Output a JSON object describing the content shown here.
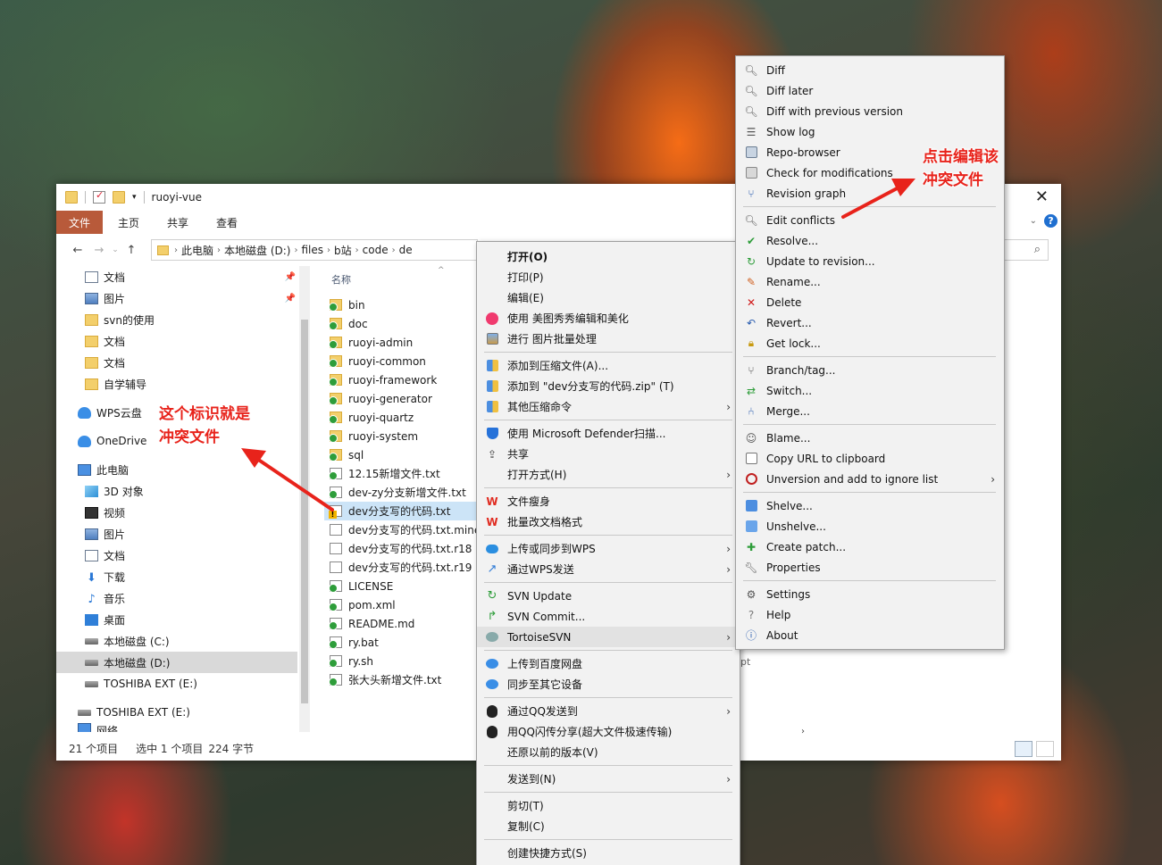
{
  "window": {
    "title": "ruoyi-vue",
    "tabs": [
      "文件",
      "主页",
      "共享",
      "查看"
    ],
    "breadcrumb": [
      "此电脑",
      "本地磁盘 (D:)",
      "files",
      "b站",
      "code",
      "de"
    ]
  },
  "nav_pane": [
    {
      "label": "文档",
      "icon": "doc",
      "pinned": true
    },
    {
      "label": "图片",
      "icon": "pic",
      "pinned": true
    },
    {
      "label": "svn的使用",
      "icon": "folder"
    },
    {
      "label": "文档",
      "icon": "folder"
    },
    {
      "label": "文档",
      "icon": "folder"
    },
    {
      "label": "自学辅导",
      "icon": "folder"
    },
    {
      "label": "WPS云盘",
      "icon": "cloud"
    },
    {
      "label": "OneDrive",
      "icon": "cloud"
    },
    {
      "label": "此电脑",
      "icon": "pc"
    },
    {
      "label": "3D 对象",
      "icon": "3d"
    },
    {
      "label": "视频",
      "icon": "video"
    },
    {
      "label": "图片",
      "icon": "pic"
    },
    {
      "label": "文档",
      "icon": "doc"
    },
    {
      "label": "下载",
      "icon": "down"
    },
    {
      "label": "音乐",
      "icon": "music"
    },
    {
      "label": "桌面",
      "icon": "desk"
    },
    {
      "label": "本地磁盘 (C:)",
      "icon": "drive"
    },
    {
      "label": "本地磁盘 (D:)",
      "icon": "drive",
      "selected": true
    },
    {
      "label": "TOSHIBA EXT (E:)",
      "icon": "drive"
    },
    {
      "label": "TOSHIBA EXT (E:)",
      "icon": "drive"
    },
    {
      "label": "网络",
      "icon": "pc"
    }
  ],
  "file_header": "名称",
  "files": [
    {
      "name": "bin",
      "type": "folder",
      "status": "ok"
    },
    {
      "name": "doc",
      "type": "folder",
      "status": "ok"
    },
    {
      "name": "ruoyi-admin",
      "type": "folder",
      "status": "ok"
    },
    {
      "name": "ruoyi-common",
      "type": "folder",
      "status": "ok"
    },
    {
      "name": "ruoyi-framework",
      "type": "folder",
      "status": "ok"
    },
    {
      "name": "ruoyi-generator",
      "type": "folder",
      "status": "ok"
    },
    {
      "name": "ruoyi-quartz",
      "type": "folder",
      "status": "ok"
    },
    {
      "name": "ruoyi-system",
      "type": "folder",
      "status": "ok"
    },
    {
      "name": "sql",
      "type": "folder",
      "status": "ok"
    },
    {
      "name": "12.15新增文件.txt",
      "type": "txt",
      "status": "ok"
    },
    {
      "name": "dev-zy分支新增文件.txt",
      "type": "txt",
      "status": "ok"
    },
    {
      "name": "dev分支写的代码.txt",
      "type": "txt",
      "status": "conflict",
      "selected": true
    },
    {
      "name": "dev分支写的代码.txt.mine",
      "type": "txt",
      "status": "none"
    },
    {
      "name": "dev分支写的代码.txt.r18",
      "type": "txt",
      "status": "none"
    },
    {
      "name": "dev分支写的代码.txt.r19",
      "type": "txt",
      "status": "none"
    },
    {
      "name": "LICENSE",
      "type": "txt",
      "status": "ok"
    },
    {
      "name": "pom.xml",
      "type": "txt",
      "status": "ok"
    },
    {
      "name": "README.md",
      "type": "txt",
      "status": "ok"
    },
    {
      "name": "ry.bat",
      "type": "txt",
      "status": "ok"
    },
    {
      "name": "ry.sh",
      "type": "txt",
      "status": "ok"
    },
    {
      "name": "张大头新增文件.txt",
      "type": "txt",
      "status": "ok"
    }
  ],
  "partial_text": "pt",
  "status_bar": {
    "count": "21 个项目",
    "selection": "选中 1 个项目",
    "size": "224 字节"
  },
  "context_menu": [
    {
      "label": "打开(O)",
      "bold": true
    },
    {
      "label": "打印(P)"
    },
    {
      "label": "编辑(E)"
    },
    {
      "label": "使用 美图秀秀编辑和美化",
      "icon": "meitu"
    },
    {
      "label": "进行 图片批量处理",
      "icon": "image"
    },
    {
      "sep": true
    },
    {
      "label": "添加到压缩文件(A)...",
      "icon": "zip"
    },
    {
      "label": "添加到 \"dev分支写的代码.zip\" (T)",
      "icon": "zip"
    },
    {
      "label": "其他压缩命令",
      "icon": "zip",
      "submenu": true
    },
    {
      "sep": true
    },
    {
      "label": "使用 Microsoft Defender扫描...",
      "icon": "shield"
    },
    {
      "label": "共享",
      "icon": "share"
    },
    {
      "label": "打开方式(H)",
      "submenu": true
    },
    {
      "sep": true
    },
    {
      "label": "文件瘦身",
      "icon": "wps"
    },
    {
      "label": "批量改文档格式",
      "icon": "wps"
    },
    {
      "sep": true
    },
    {
      "label": "上传或同步到WPS",
      "icon": "cloud",
      "submenu": true
    },
    {
      "label": "通过WPS发送",
      "icon": "send",
      "submenu": true
    },
    {
      "sep": true
    },
    {
      "label": "SVN Update",
      "icon": "svn-update"
    },
    {
      "label": "SVN Commit...",
      "icon": "svn-commit"
    },
    {
      "label": "TortoiseSVN",
      "icon": "tortoise",
      "submenu": true,
      "highlight": true
    },
    {
      "sep": true
    },
    {
      "label": "上传到百度网盘",
      "icon": "baidu"
    },
    {
      "label": "同步至其它设备",
      "icon": "baidu"
    },
    {
      "sep": true
    },
    {
      "label": "通过QQ发送到",
      "icon": "qq",
      "submenu": true
    },
    {
      "label": "用QQ闪传分享(超大文件极速传输)",
      "icon": "qq"
    },
    {
      "label": "还原以前的版本(V)"
    },
    {
      "sep": true
    },
    {
      "label": "发送到(N)",
      "submenu": true
    },
    {
      "sep": true
    },
    {
      "label": "剪切(T)"
    },
    {
      "label": "复制(C)"
    },
    {
      "sep": true
    },
    {
      "label": "创建快捷方式(S)"
    }
  ],
  "svn_menu": [
    {
      "label": "Diff",
      "icon": "magnifier"
    },
    {
      "label": "Diff later",
      "icon": "magnifier"
    },
    {
      "label": "Diff with previous version",
      "icon": "magnifier"
    },
    {
      "label": "Show log",
      "icon": "log"
    },
    {
      "label": "Repo-browser",
      "icon": "repo"
    },
    {
      "label": "Check for modifications",
      "icon": "check"
    },
    {
      "label": "Revision graph",
      "icon": "graph"
    },
    {
      "sep": true
    },
    {
      "label": "Edit conflicts",
      "icon": "magnifier"
    },
    {
      "label": "Resolve...",
      "icon": "resolve"
    },
    {
      "label": "Update to revision...",
      "icon": "update"
    },
    {
      "label": "Rename...",
      "icon": "rename"
    },
    {
      "label": "Delete",
      "icon": "delete"
    },
    {
      "label": "Revert...",
      "icon": "revert"
    },
    {
      "label": "Get lock...",
      "icon": "lock"
    },
    {
      "sep": true
    },
    {
      "label": "Branch/tag...",
      "icon": "branch"
    },
    {
      "label": "Switch...",
      "icon": "switch"
    },
    {
      "label": "Merge...",
      "icon": "merge"
    },
    {
      "sep": true
    },
    {
      "label": "Blame...",
      "icon": "blame"
    },
    {
      "label": "Copy URL to clipboard",
      "icon": "copy"
    },
    {
      "label": "Unversion and add to ignore list",
      "icon": "ignore",
      "submenu": true
    },
    {
      "sep": true
    },
    {
      "label": "Shelve...",
      "icon": "shelve"
    },
    {
      "label": "Unshelve...",
      "icon": "unshelve"
    },
    {
      "label": "Create patch...",
      "icon": "patch"
    },
    {
      "label": "Properties",
      "icon": "props"
    },
    {
      "sep": true
    },
    {
      "label": "Settings",
      "icon": "settings"
    },
    {
      "label": "Help",
      "icon": "help"
    },
    {
      "label": "About",
      "icon": "about"
    }
  ],
  "annotations": {
    "left": [
      "这个标识就是",
      "冲突文件"
    ],
    "right": [
      "点击编辑该",
      "冲突文件"
    ]
  },
  "colors": {
    "accent": "#b85a3a",
    "annotation": "#e8231b",
    "selection": "#cce4f7",
    "conflict": "#f2b400",
    "ok": "#2e9d3a"
  }
}
